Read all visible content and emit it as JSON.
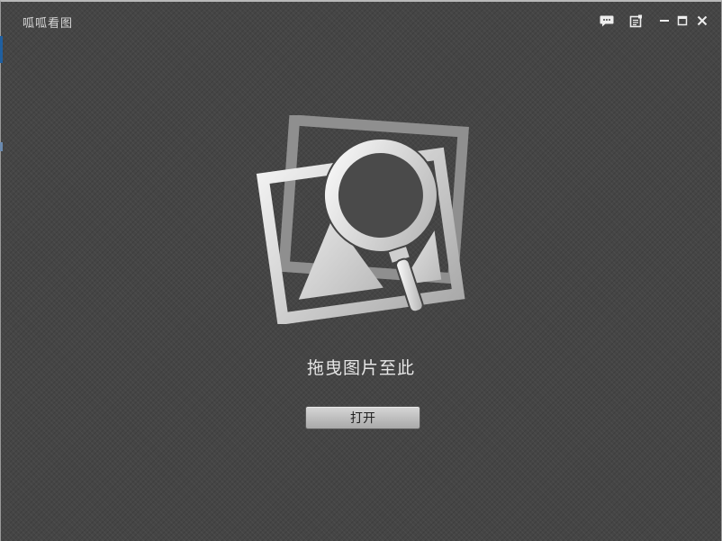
{
  "window": {
    "title": "呱呱看图"
  },
  "titlebar": {
    "buttons": [
      {
        "name": "feedback",
        "icon": "chat-bubble-icon"
      },
      {
        "name": "notes",
        "icon": "notepad-icon"
      },
      {
        "name": "minimize",
        "icon": "minimize-icon"
      },
      {
        "name": "maximize",
        "icon": "maximize-icon"
      },
      {
        "name": "close",
        "icon": "close-icon"
      }
    ]
  },
  "main": {
    "hero_icon": "image-search-icon",
    "drop_hint": "拖曳图片至此",
    "open_label": "打开"
  },
  "colors": {
    "background": "#454545",
    "text": "#e6e6e6",
    "button": "#c4c4c4"
  }
}
